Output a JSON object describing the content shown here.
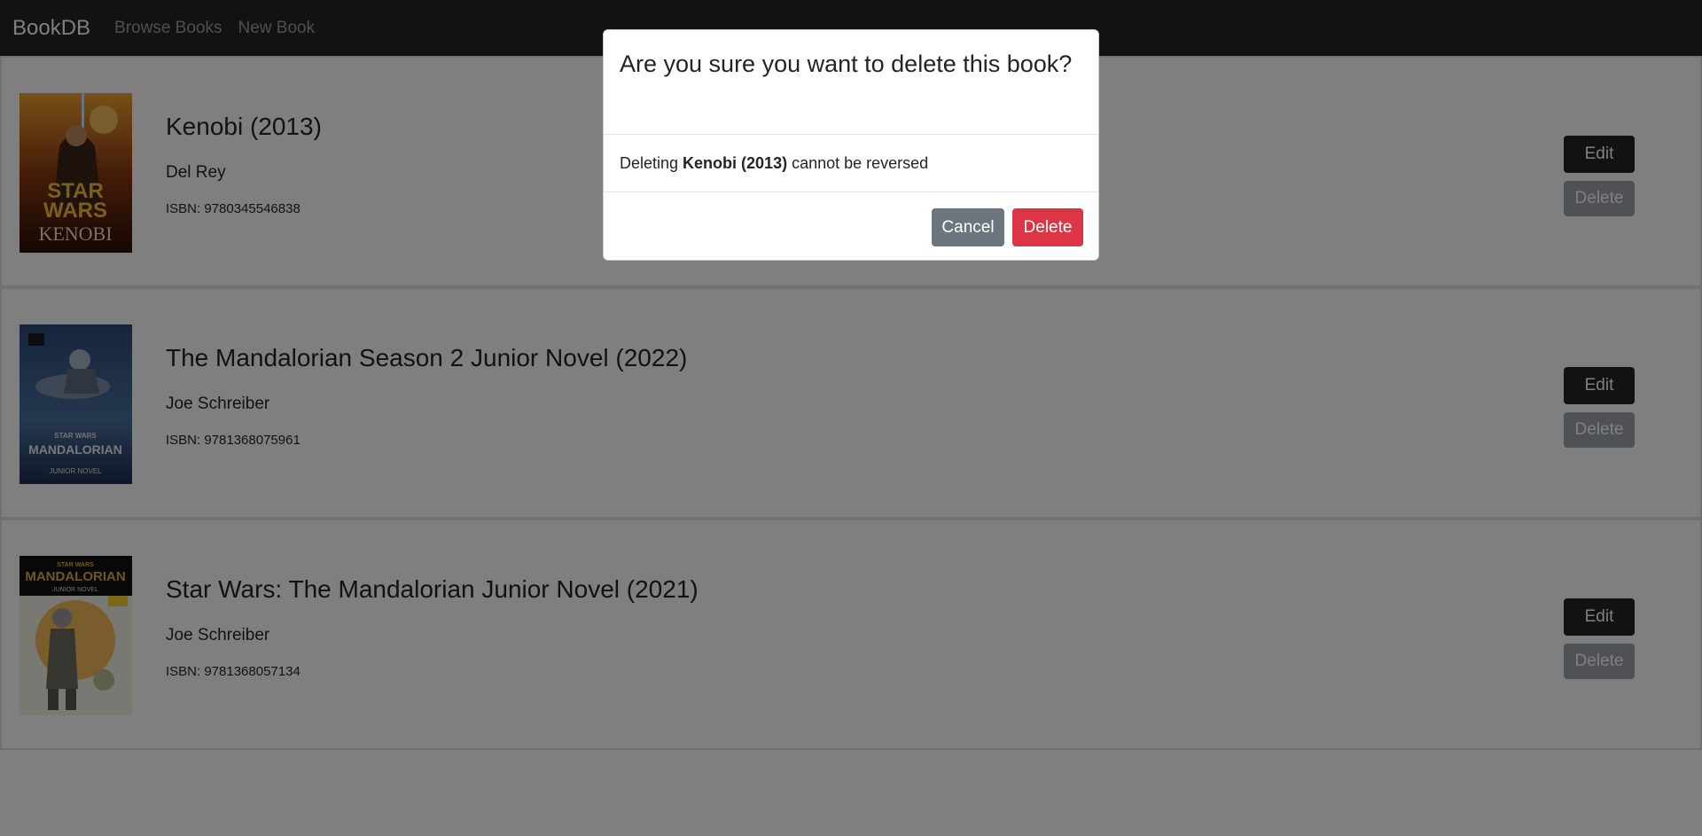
{
  "nav": {
    "brand": "BookDB",
    "links": [
      "Browse Books",
      "New Book"
    ]
  },
  "books": [
    {
      "title": "Kenobi (2013)",
      "author": "Del Rey",
      "isbn": "ISBN: 9780345546838",
      "edit_label": "Edit",
      "delete_label": "Delete",
      "cover": {
        "top_text": "STAR",
        "mid_text": "WARS",
        "bottom_text": "KENOBI"
      }
    },
    {
      "title": "The Mandalorian Season 2 Junior Novel (2022)",
      "author": "Joe Schreiber",
      "isbn": "ISBN: 9781368075961",
      "edit_label": "Edit",
      "delete_label": "Delete",
      "cover": {
        "top_text": "STAR WARS",
        "mid_text": "MANDALORIAN",
        "bottom_text": "JUNIOR NOVEL"
      }
    },
    {
      "title": "Star Wars: The Mandalorian Junior Novel (2021)",
      "author": "Joe Schreiber",
      "isbn": "ISBN: 9781368057134",
      "edit_label": "Edit",
      "delete_label": "Delete",
      "cover": {
        "top_text": "STAR WARS",
        "mid_text": "MANDALORIAN",
        "bottom_text": "JUNIOR NOVEL"
      }
    }
  ],
  "modal": {
    "title": "Are you sure you want to delete this book?",
    "body_prefix": "Deleting",
    "body_book": "Kenobi (2013)",
    "body_suffix": "cannot be reversed",
    "cancel_label": "Cancel",
    "delete_label": "Delete"
  },
  "colors": {
    "navbar": "#212529",
    "edit_button": "#212529",
    "delete_button": "#6c757d",
    "confirm_delete": "#dc3545",
    "cancel": "#6c757d"
  }
}
